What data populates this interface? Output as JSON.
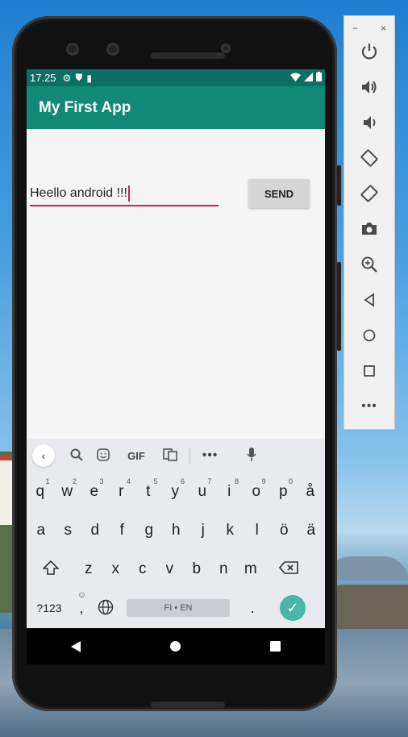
{
  "status_bar": {
    "time": "17.25"
  },
  "app_bar": {
    "title": "My First App"
  },
  "message": {
    "value": "Heello android !!!"
  },
  "send_button": {
    "label": "SEND"
  },
  "keyboard": {
    "row1": [
      {
        "key": "q",
        "hint": "1"
      },
      {
        "key": "w",
        "hint": "2"
      },
      {
        "key": "e",
        "hint": "3"
      },
      {
        "key": "r",
        "hint": "4"
      },
      {
        "key": "t",
        "hint": "5"
      },
      {
        "key": "y",
        "hint": "6"
      },
      {
        "key": "u",
        "hint": "7"
      },
      {
        "key": "i",
        "hint": "8"
      },
      {
        "key": "o",
        "hint": "9"
      },
      {
        "key": "p",
        "hint": "0"
      },
      {
        "key": "å",
        "hint": ""
      }
    ],
    "row2": [
      "a",
      "s",
      "d",
      "f",
      "g",
      "h",
      "j",
      "k",
      "l",
      "ö",
      "ä"
    ],
    "row3": [
      "z",
      "x",
      "c",
      "v",
      "b",
      "n",
      "m"
    ],
    "symbols_label": "?123",
    "comma": ",",
    "space_label": "FI • EN",
    "period": ".",
    "toolbar_gif": "GIF"
  },
  "emulator_panel": {
    "minimize": "−",
    "close": "×",
    "buttons": [
      "power-icon",
      "volume-up-icon",
      "volume-down-icon",
      "rotate-left-icon",
      "rotate-right-icon",
      "camera-icon",
      "zoom-icon",
      "back-icon",
      "home-icon",
      "overview-icon",
      "more-icon"
    ]
  },
  "colors": {
    "status_bar": "#0b7063",
    "app_bar": "#128877",
    "accent": "#d81b60",
    "enter_key": "#49b6a6"
  }
}
